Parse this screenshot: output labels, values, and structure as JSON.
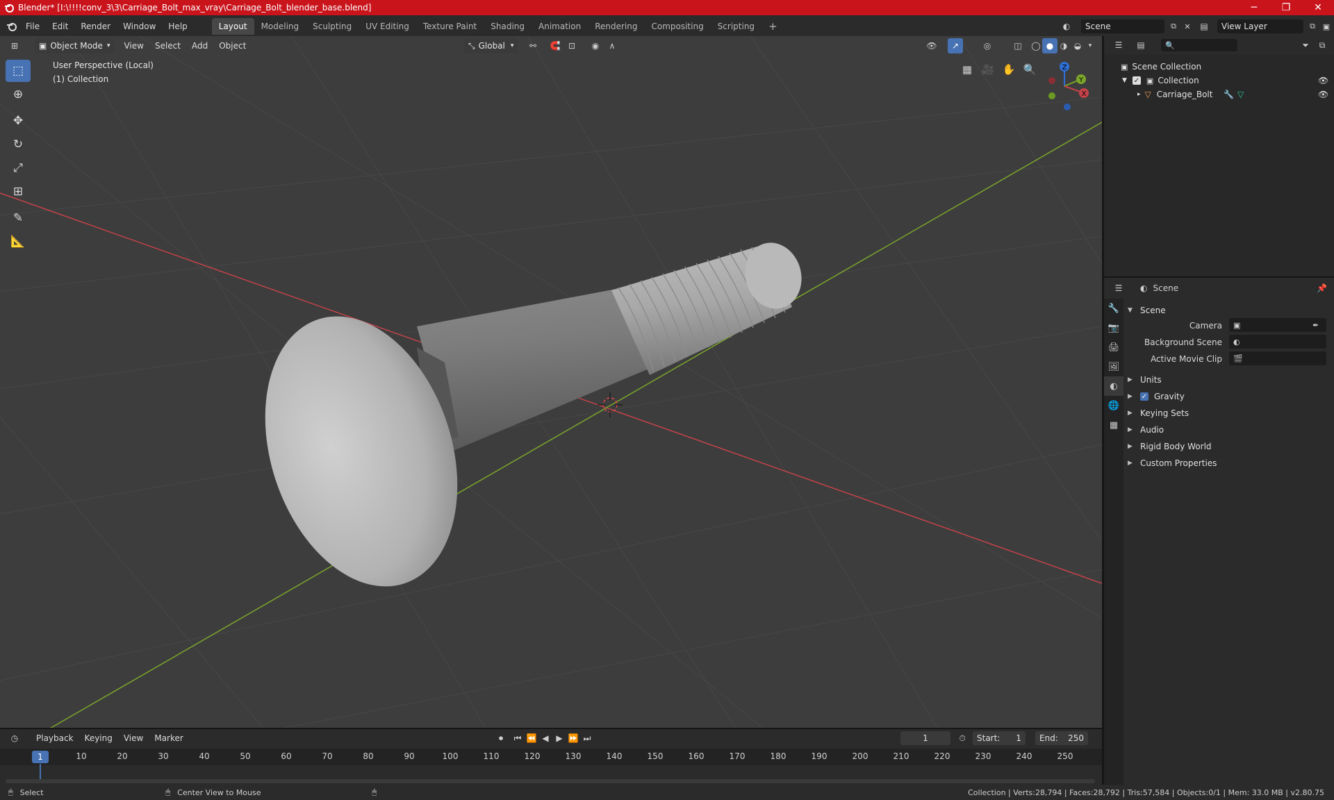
{
  "window": {
    "title": "Blender* [I:\\!!!!conv_3\\3\\Carriage_Bolt_max_vray\\Carriage_Bolt_blender_base.blend]",
    "minimize": "─",
    "maximize": "❐",
    "close": "✕"
  },
  "menu": [
    "File",
    "Edit",
    "Render",
    "Window",
    "Help"
  ],
  "workspaces": [
    "Layout",
    "Modeling",
    "Sculpting",
    "UV Editing",
    "Texture Paint",
    "Shading",
    "Animation",
    "Rendering",
    "Compositing",
    "Scripting"
  ],
  "workspace_add": "+",
  "scene_field": "Scene",
  "view_layer_field": "View Layer",
  "viewport_header": {
    "mode": "Object Mode",
    "menus": [
      "View",
      "Select",
      "Add",
      "Object"
    ],
    "transform_orientation": "Global"
  },
  "viewport_info": {
    "line1": "User Perspective (Local)",
    "line2": "(1) Collection"
  },
  "gizmo": {
    "x": "X",
    "y": "Y",
    "z": "Z"
  },
  "outliner": {
    "root": "Scene Collection",
    "collection": "Collection",
    "object": "Carriage_Bolt"
  },
  "properties": {
    "header": "Scene",
    "panel_scene": "Scene",
    "camera_label": "Camera",
    "background_scene_label": "Background Scene",
    "active_movie_clip_label": "Active Movie Clip",
    "panels": [
      "Units",
      "Gravity",
      "Keying Sets",
      "Audio",
      "Rigid Body World",
      "Custom Properties"
    ]
  },
  "timeline": {
    "menus": [
      "Playback",
      "Keying",
      "View",
      "Marker"
    ],
    "current_frame": "1",
    "start_label": "Start:",
    "start_value": "1",
    "end_label": "End:",
    "end_value": "250",
    "ruler": [
      "10",
      "20",
      "30",
      "40",
      "50",
      "60",
      "70",
      "80",
      "90",
      "100",
      "110",
      "120",
      "130",
      "140",
      "150",
      "160",
      "170",
      "180",
      "190",
      "200",
      "210",
      "220",
      "230",
      "240",
      "250"
    ],
    "ruler_current": "1"
  },
  "status": {
    "select": "Select",
    "center_view": "Center View to Mouse",
    "stats": "Collection | Verts:28,794 | Faces:28,792 | Tris:57,584 | Objects:0/1 | Mem: 33.0 MB | v2.80.75"
  },
  "colors": {
    "titlebar": "#c9141c",
    "accent": "#4772b3",
    "viewport_bg": "#3d3d3d",
    "x_axis": "#c6434a",
    "y_axis": "#7ba62a"
  }
}
